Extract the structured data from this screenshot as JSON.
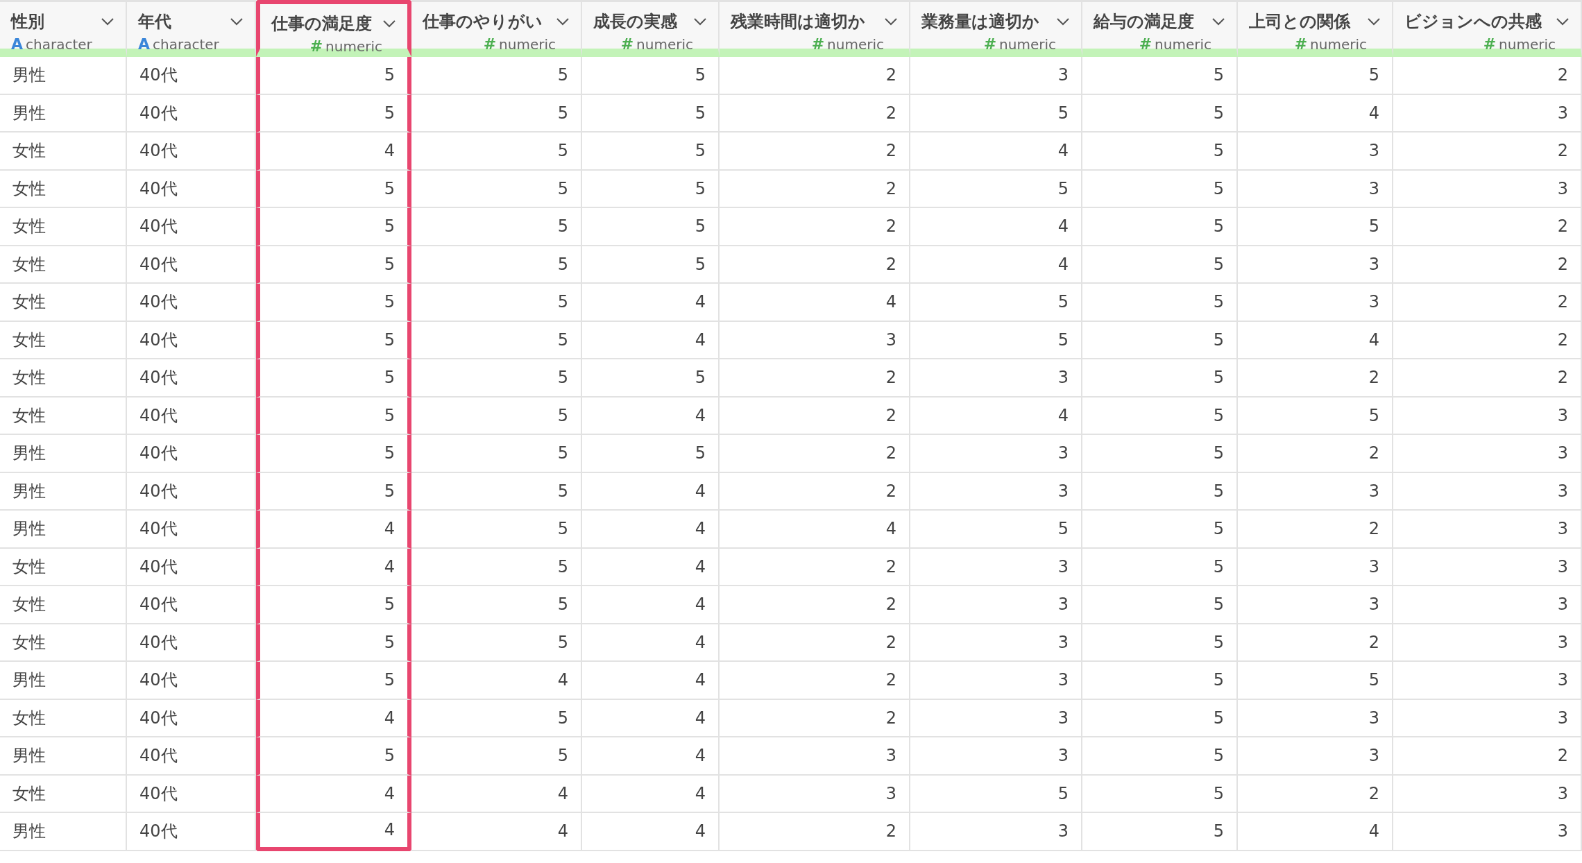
{
  "table": {
    "columns": [
      {
        "name": "性別",
        "type_icon": "A",
        "type": "character",
        "highlighted": false
      },
      {
        "name": "年代",
        "type_icon": "A",
        "type": "character",
        "highlighted": false
      },
      {
        "name": "仕事の満足度",
        "type_icon": "#",
        "type": "numeric",
        "highlighted": true
      },
      {
        "name": "仕事のやりがい",
        "type_icon": "#",
        "type": "numeric",
        "highlighted": false
      },
      {
        "name": "成長の実感",
        "type_icon": "#",
        "type": "numeric",
        "highlighted": false
      },
      {
        "name": "残業時間は適切か",
        "type_icon": "#",
        "type": "numeric",
        "highlighted": false
      },
      {
        "name": "業務量は適切か",
        "type_icon": "#",
        "type": "numeric",
        "highlighted": false
      },
      {
        "name": "給与の満足度",
        "type_icon": "#",
        "type": "numeric",
        "highlighted": false
      },
      {
        "name": "上司との関係",
        "type_icon": "#",
        "type": "numeric",
        "highlighted": false
      },
      {
        "name": "ビジョンへの共感",
        "type_icon": "#",
        "type": "numeric",
        "highlighted": false
      }
    ],
    "rows": [
      [
        "男性",
        "40代",
        "5",
        "5",
        "5",
        "2",
        "3",
        "5",
        "5",
        "2"
      ],
      [
        "男性",
        "40代",
        "5",
        "5",
        "5",
        "2",
        "5",
        "5",
        "4",
        "3"
      ],
      [
        "女性",
        "40代",
        "4",
        "5",
        "5",
        "2",
        "4",
        "5",
        "3",
        "2"
      ],
      [
        "女性",
        "40代",
        "5",
        "5",
        "5",
        "2",
        "5",
        "5",
        "3",
        "3"
      ],
      [
        "女性",
        "40代",
        "5",
        "5",
        "5",
        "2",
        "4",
        "5",
        "5",
        "2"
      ],
      [
        "女性",
        "40代",
        "5",
        "5",
        "5",
        "2",
        "4",
        "5",
        "3",
        "2"
      ],
      [
        "女性",
        "40代",
        "5",
        "5",
        "4",
        "4",
        "5",
        "5",
        "3",
        "2"
      ],
      [
        "女性",
        "40代",
        "5",
        "5",
        "4",
        "3",
        "5",
        "5",
        "4",
        "2"
      ],
      [
        "女性",
        "40代",
        "5",
        "5",
        "5",
        "2",
        "3",
        "5",
        "2",
        "2"
      ],
      [
        "女性",
        "40代",
        "5",
        "5",
        "4",
        "2",
        "4",
        "5",
        "5",
        "3"
      ],
      [
        "男性",
        "40代",
        "5",
        "5",
        "5",
        "2",
        "3",
        "5",
        "2",
        "3"
      ],
      [
        "男性",
        "40代",
        "5",
        "5",
        "4",
        "2",
        "3",
        "5",
        "3",
        "3"
      ],
      [
        "男性",
        "40代",
        "4",
        "5",
        "4",
        "4",
        "5",
        "5",
        "2",
        "3"
      ],
      [
        "女性",
        "40代",
        "4",
        "5",
        "4",
        "2",
        "3",
        "5",
        "3",
        "3"
      ],
      [
        "女性",
        "40代",
        "5",
        "5",
        "4",
        "2",
        "3",
        "5",
        "3",
        "3"
      ],
      [
        "女性",
        "40代",
        "5",
        "5",
        "4",
        "2",
        "3",
        "5",
        "2",
        "3"
      ],
      [
        "男性",
        "40代",
        "5",
        "4",
        "4",
        "2",
        "3",
        "5",
        "5",
        "3"
      ],
      [
        "女性",
        "40代",
        "4",
        "5",
        "4",
        "2",
        "3",
        "5",
        "3",
        "3"
      ],
      [
        "男性",
        "40代",
        "5",
        "5",
        "4",
        "3",
        "3",
        "5",
        "3",
        "2"
      ],
      [
        "女性",
        "40代",
        "4",
        "4",
        "4",
        "3",
        "5",
        "5",
        "2",
        "3"
      ],
      [
        "男性",
        "40代",
        "4",
        "4",
        "4",
        "2",
        "3",
        "5",
        "4",
        "3"
      ]
    ]
  }
}
